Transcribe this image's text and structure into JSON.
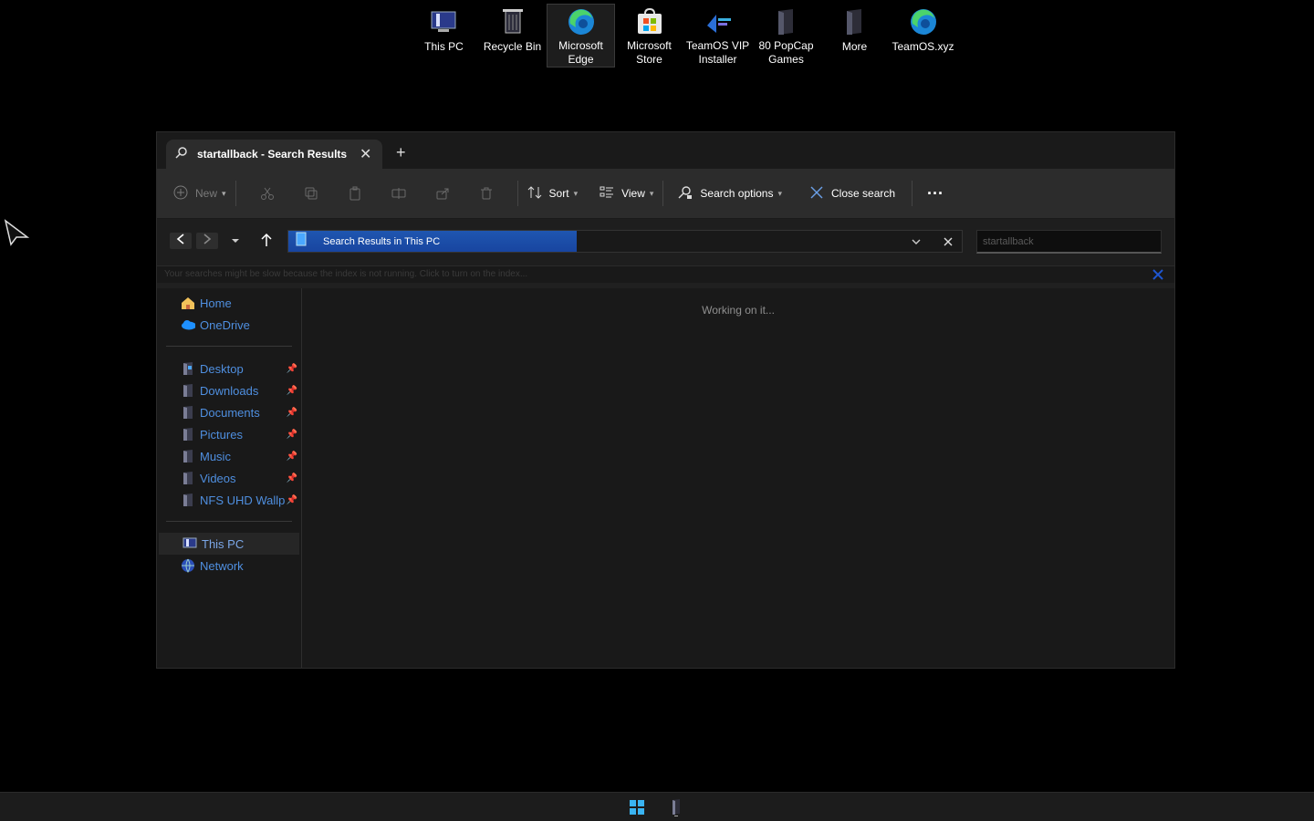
{
  "desktop": {
    "icons": [
      {
        "label": "This PC",
        "icon": "this-pc-icon"
      },
      {
        "label": "Recycle Bin",
        "icon": "recycle-bin-icon"
      },
      {
        "label": "Microsoft Edge",
        "icon": "edge-icon"
      },
      {
        "label": "Microsoft Store",
        "icon": "store-icon"
      },
      {
        "label": "TeamOS VIP Installer",
        "icon": "installer-icon"
      },
      {
        "label": "80 PopCap Games",
        "icon": "folder-icon"
      },
      {
        "label": "More",
        "icon": "folder-icon"
      },
      {
        "label": "TeamOS.xyz",
        "icon": "edge-icon"
      }
    ]
  },
  "window": {
    "tab": {
      "title": "startallback - Search Results in This PC",
      "close": "✕"
    },
    "new_tab": "+",
    "toolbar": {
      "new": "New",
      "sort": "Sort",
      "view": "View",
      "search_options": "Search options",
      "close_search": "Close search",
      "more": "···"
    },
    "address": {
      "location": "Search Results in This PC",
      "search_value": "startallback"
    },
    "infobar": "Your searches might be slow because the index is not running.  Click to turn on the index...",
    "nav": {
      "quick": [
        {
          "label": "Home"
        },
        {
          "label": "OneDrive"
        }
      ],
      "pinned": [
        {
          "label": "Desktop"
        },
        {
          "label": "Downloads"
        },
        {
          "label": "Documents"
        },
        {
          "label": "Pictures"
        },
        {
          "label": "Music"
        },
        {
          "label": "Videos"
        },
        {
          "label": "NFS UHD Wallp"
        }
      ],
      "devices": [
        {
          "label": "This PC"
        },
        {
          "label": "Network"
        }
      ]
    },
    "status": "Working on it..."
  },
  "colors": {
    "accent": "#1f56b0",
    "link": "#4f8fe0"
  }
}
